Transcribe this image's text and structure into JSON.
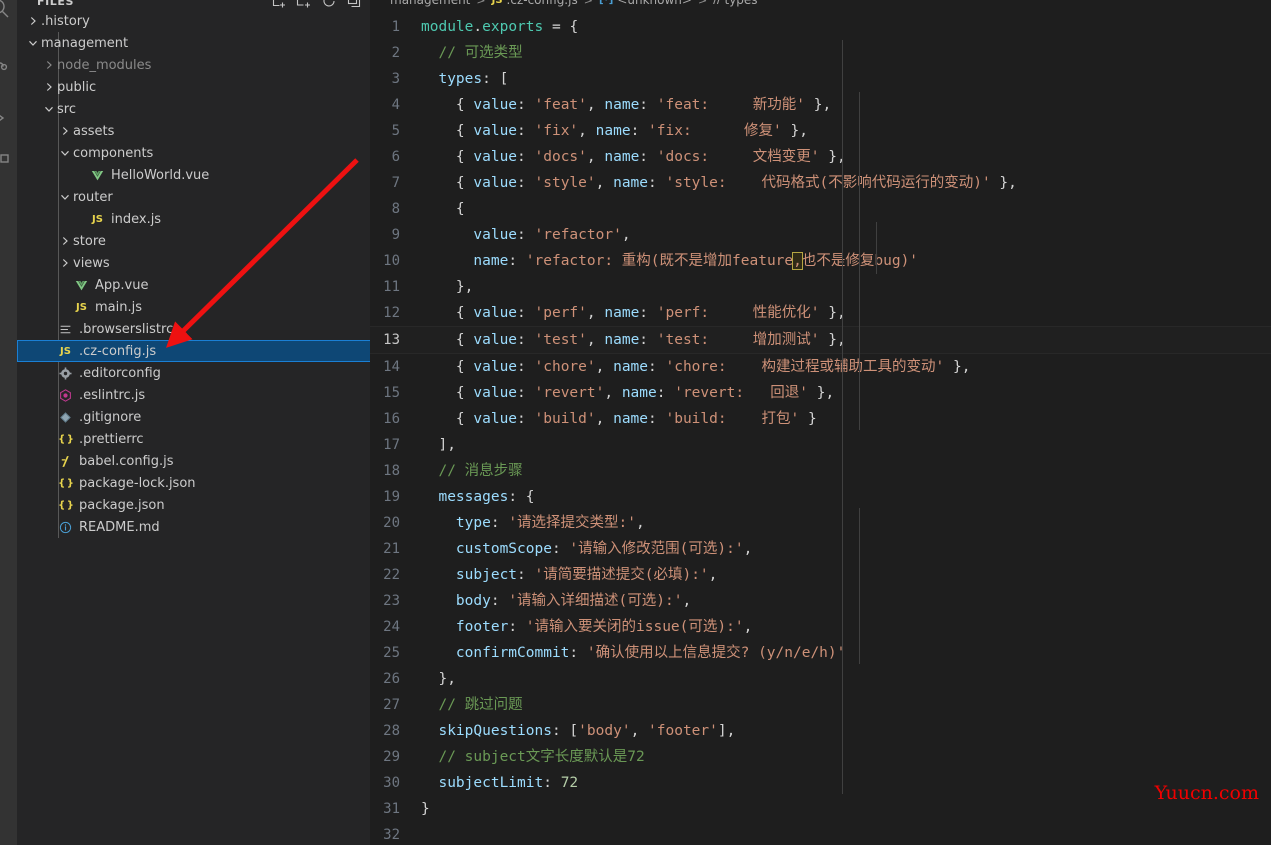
{
  "theme": {
    "editor_bg": "#1e1e1e",
    "sidebar_bg": "#252526",
    "activitybar_bg": "#333333",
    "selection_bg": "#0e4775",
    "selection_border": "#1a7fd4",
    "accent_arrow": "#ee1111",
    "watermark_color": "#f00000"
  },
  "activitybar": {
    "items": [
      {
        "name": "search-icon"
      },
      {
        "name": "source-control-icon"
      },
      {
        "name": "run-and-debug-icon"
      },
      {
        "name": "extensions-icon"
      }
    ]
  },
  "sidebar": {
    "title": "FILES",
    "actions": [
      {
        "name": "new-file-icon",
        "tooltip": "New File"
      },
      {
        "name": "new-folder-icon",
        "tooltip": "New Folder"
      },
      {
        "name": "refresh-icon",
        "tooltip": "Refresh Explorer"
      },
      {
        "name": "collapse-all-icon",
        "tooltip": "Collapse Folders in Explorer"
      }
    ],
    "tree": [
      {
        "label": ".history",
        "kind": "folder",
        "expanded": false,
        "depth": 1,
        "icon": "chevron-right-icon",
        "dim": false
      },
      {
        "label": "management",
        "kind": "folder",
        "expanded": true,
        "depth": 1,
        "icon": "chevron-down-icon",
        "dim": false
      },
      {
        "label": "node_modules",
        "kind": "folder",
        "expanded": false,
        "depth": 2,
        "icon": "chevron-right-icon",
        "dim": true
      },
      {
        "label": "public",
        "kind": "folder",
        "expanded": false,
        "depth": 2,
        "icon": "chevron-right-icon",
        "dim": false
      },
      {
        "label": "src",
        "kind": "folder",
        "expanded": true,
        "depth": 2,
        "icon": "chevron-down-icon",
        "dim": false
      },
      {
        "label": "assets",
        "kind": "folder",
        "expanded": false,
        "depth": 3,
        "icon": "chevron-right-icon",
        "dim": false
      },
      {
        "label": "components",
        "kind": "folder",
        "expanded": true,
        "depth": 3,
        "icon": "chevron-down-icon",
        "dim": false
      },
      {
        "label": "HelloWorld.vue",
        "kind": "file",
        "depth": 4,
        "icon": "vue-file-icon",
        "dim": false
      },
      {
        "label": "router",
        "kind": "folder",
        "expanded": true,
        "depth": 3,
        "icon": "chevron-down-icon",
        "dim": false
      },
      {
        "label": "index.js",
        "kind": "file",
        "depth": 4,
        "icon": "js-file-icon",
        "dim": false
      },
      {
        "label": "store",
        "kind": "folder",
        "expanded": false,
        "depth": 3,
        "icon": "chevron-right-icon",
        "dim": false
      },
      {
        "label": "views",
        "kind": "folder",
        "expanded": false,
        "depth": 3,
        "icon": "chevron-right-icon",
        "dim": false
      },
      {
        "label": "App.vue",
        "kind": "file",
        "depth": 3,
        "icon": "vue-file-icon",
        "dim": false
      },
      {
        "label": "main.js",
        "kind": "file",
        "depth": 3,
        "icon": "js-file-icon",
        "dim": false
      },
      {
        "label": ".browserslistrc",
        "kind": "file",
        "depth": 2,
        "icon": "config-list-icon",
        "dim": false
      },
      {
        "label": ".cz-config.js",
        "kind": "file",
        "depth": 2,
        "icon": "js-file-icon",
        "dim": false,
        "selected": true
      },
      {
        "label": ".editorconfig",
        "kind": "file",
        "depth": 2,
        "icon": "gear-file-icon",
        "dim": false
      },
      {
        "label": ".eslintrc.js",
        "kind": "file",
        "depth": 2,
        "icon": "eslint-file-icon",
        "dim": false
      },
      {
        "label": ".gitignore",
        "kind": "file",
        "depth": 2,
        "icon": "git-file-icon",
        "dim": false
      },
      {
        "label": ".prettierrc",
        "kind": "file",
        "depth": 2,
        "icon": "json-file-icon",
        "dim": false
      },
      {
        "label": "babel.config.js",
        "kind": "file",
        "depth": 2,
        "icon": "babel-file-icon",
        "dim": false
      },
      {
        "label": "package-lock.json",
        "kind": "file",
        "depth": 2,
        "icon": "json-file-icon",
        "dim": false
      },
      {
        "label": "package.json",
        "kind": "file",
        "depth": 2,
        "icon": "json-file-icon",
        "dim": false
      },
      {
        "label": "README.md",
        "kind": "file",
        "depth": 2,
        "icon": "markdown-info-icon",
        "dim": false
      }
    ]
  },
  "breadcrumb": {
    "items": [
      {
        "label": "management",
        "icon": null
      },
      {
        "label": ".cz-config.js",
        "icon": "js-file-icon"
      },
      {
        "label": "<unknown>",
        "icon": "module-icon"
      },
      {
        "label": "types",
        "icon": "property-icon"
      }
    ],
    "separator": ">"
  },
  "editor": {
    "active_line": 13,
    "line_count_visible": 32,
    "selection_text": ",",
    "lines": [
      {
        "n": 1,
        "tokens": [
          {
            "t": "module",
            "c": "teal"
          },
          {
            "t": ".",
            "c": "white"
          },
          {
            "t": "exports",
            "c": "teal"
          },
          {
            "t": " = ",
            "c": "white"
          },
          {
            "t": "{",
            "c": "punct"
          }
        ]
      },
      {
        "n": 2,
        "tokens": [
          {
            "t": "  ",
            "c": "white"
          },
          {
            "t": "// 可选类型",
            "c": "com"
          }
        ]
      },
      {
        "n": 3,
        "tokens": [
          {
            "t": "  ",
            "c": "white"
          },
          {
            "t": "types",
            "c": "lblue"
          },
          {
            "t": ": [",
            "c": "punct"
          }
        ]
      },
      {
        "n": 4,
        "tokens": [
          {
            "t": "    { ",
            "c": "punct"
          },
          {
            "t": "value",
            "c": "lblue"
          },
          {
            "t": ": ",
            "c": "punct"
          },
          {
            "t": "'feat'",
            "c": "str"
          },
          {
            "t": ", ",
            "c": "punct"
          },
          {
            "t": "name",
            "c": "lblue"
          },
          {
            "t": ": ",
            "c": "punct"
          },
          {
            "t": "'feat:     新功能'",
            "c": "str"
          },
          {
            "t": " },",
            "c": "punct"
          }
        ]
      },
      {
        "n": 5,
        "tokens": [
          {
            "t": "    { ",
            "c": "punct"
          },
          {
            "t": "value",
            "c": "lblue"
          },
          {
            "t": ": ",
            "c": "punct"
          },
          {
            "t": "'fix'",
            "c": "str"
          },
          {
            "t": ", ",
            "c": "punct"
          },
          {
            "t": "name",
            "c": "lblue"
          },
          {
            "t": ": ",
            "c": "punct"
          },
          {
            "t": "'fix:      修复'",
            "c": "str"
          },
          {
            "t": " },",
            "c": "punct"
          }
        ]
      },
      {
        "n": 6,
        "tokens": [
          {
            "t": "    { ",
            "c": "punct"
          },
          {
            "t": "value",
            "c": "lblue"
          },
          {
            "t": ": ",
            "c": "punct"
          },
          {
            "t": "'docs'",
            "c": "str"
          },
          {
            "t": ", ",
            "c": "punct"
          },
          {
            "t": "name",
            "c": "lblue"
          },
          {
            "t": ": ",
            "c": "punct"
          },
          {
            "t": "'docs:     文档变更'",
            "c": "str"
          },
          {
            "t": " },",
            "c": "punct"
          }
        ]
      },
      {
        "n": 7,
        "tokens": [
          {
            "t": "    { ",
            "c": "punct"
          },
          {
            "t": "value",
            "c": "lblue"
          },
          {
            "t": ": ",
            "c": "punct"
          },
          {
            "t": "'style'",
            "c": "str"
          },
          {
            "t": ", ",
            "c": "punct"
          },
          {
            "t": "name",
            "c": "lblue"
          },
          {
            "t": ": ",
            "c": "punct"
          },
          {
            "t": "'style:    代码格式(不影响代码运行的变动)'",
            "c": "str"
          },
          {
            "t": " },",
            "c": "punct"
          }
        ]
      },
      {
        "n": 8,
        "tokens": [
          {
            "t": "    {",
            "c": "punct"
          }
        ]
      },
      {
        "n": 9,
        "tokens": [
          {
            "t": "      ",
            "c": "white"
          },
          {
            "t": "value",
            "c": "lblue"
          },
          {
            "t": ": ",
            "c": "punct"
          },
          {
            "t": "'refactor'",
            "c": "str"
          },
          {
            "t": ",",
            "c": "punct"
          }
        ]
      },
      {
        "n": 10,
        "tokens": [
          {
            "t": "      ",
            "c": "white"
          },
          {
            "t": "name",
            "c": "lblue"
          },
          {
            "t": ": ",
            "c": "punct"
          },
          {
            "t": "'refactor: 重构(既不是增加feature",
            "c": "str"
          },
          {
            "t": ",",
            "c": "str",
            "sel": true
          },
          {
            "t": "也不是修复bug)'",
            "c": "str"
          }
        ]
      },
      {
        "n": 11,
        "tokens": [
          {
            "t": "    },",
            "c": "punct"
          }
        ]
      },
      {
        "n": 12,
        "tokens": [
          {
            "t": "    { ",
            "c": "punct"
          },
          {
            "t": "value",
            "c": "lblue"
          },
          {
            "t": ": ",
            "c": "punct"
          },
          {
            "t": "'perf'",
            "c": "str"
          },
          {
            "t": ", ",
            "c": "punct"
          },
          {
            "t": "name",
            "c": "lblue"
          },
          {
            "t": ": ",
            "c": "punct"
          },
          {
            "t": "'perf:     性能优化'",
            "c": "str"
          },
          {
            "t": " },",
            "c": "punct"
          }
        ]
      },
      {
        "n": 13,
        "tokens": [
          {
            "t": "    { ",
            "c": "punct"
          },
          {
            "t": "value",
            "c": "lblue"
          },
          {
            "t": ": ",
            "c": "punct"
          },
          {
            "t": "'test'",
            "c": "str"
          },
          {
            "t": ", ",
            "c": "punct"
          },
          {
            "t": "name",
            "c": "lblue"
          },
          {
            "t": ": ",
            "c": "punct"
          },
          {
            "t": "'test:     增加测试'",
            "c": "str"
          },
          {
            "t": " },",
            "c": "punct"
          }
        ]
      },
      {
        "n": 14,
        "tokens": [
          {
            "t": "    { ",
            "c": "punct"
          },
          {
            "t": "value",
            "c": "lblue"
          },
          {
            "t": ": ",
            "c": "punct"
          },
          {
            "t": "'chore'",
            "c": "str"
          },
          {
            "t": ", ",
            "c": "punct"
          },
          {
            "t": "name",
            "c": "lblue"
          },
          {
            "t": ": ",
            "c": "punct"
          },
          {
            "t": "'chore:    构建过程或辅助工具的变动'",
            "c": "str"
          },
          {
            "t": " },",
            "c": "punct"
          }
        ]
      },
      {
        "n": 15,
        "tokens": [
          {
            "t": "    { ",
            "c": "punct"
          },
          {
            "t": "value",
            "c": "lblue"
          },
          {
            "t": ": ",
            "c": "punct"
          },
          {
            "t": "'revert'",
            "c": "str"
          },
          {
            "t": ", ",
            "c": "punct"
          },
          {
            "t": "name",
            "c": "lblue"
          },
          {
            "t": ": ",
            "c": "punct"
          },
          {
            "t": "'revert:   回退'",
            "c": "str"
          },
          {
            "t": " },",
            "c": "punct"
          }
        ]
      },
      {
        "n": 16,
        "tokens": [
          {
            "t": "    { ",
            "c": "punct"
          },
          {
            "t": "value",
            "c": "lblue"
          },
          {
            "t": ": ",
            "c": "punct"
          },
          {
            "t": "'build'",
            "c": "str"
          },
          {
            "t": ", ",
            "c": "punct"
          },
          {
            "t": "name",
            "c": "lblue"
          },
          {
            "t": ": ",
            "c": "punct"
          },
          {
            "t": "'build:    打包'",
            "c": "str"
          },
          {
            "t": " }",
            "c": "punct"
          }
        ]
      },
      {
        "n": 17,
        "tokens": [
          {
            "t": "  ],",
            "c": "punct"
          }
        ]
      },
      {
        "n": 18,
        "tokens": [
          {
            "t": "  ",
            "c": "white"
          },
          {
            "t": "// 消息步骤",
            "c": "com"
          }
        ]
      },
      {
        "n": 19,
        "tokens": [
          {
            "t": "  ",
            "c": "white"
          },
          {
            "t": "messages",
            "c": "lblue"
          },
          {
            "t": ": {",
            "c": "punct"
          }
        ]
      },
      {
        "n": 20,
        "tokens": [
          {
            "t": "    ",
            "c": "white"
          },
          {
            "t": "type",
            "c": "lblue"
          },
          {
            "t": ": ",
            "c": "punct"
          },
          {
            "t": "'请选择提交类型:'",
            "c": "str"
          },
          {
            "t": ",",
            "c": "punct"
          }
        ]
      },
      {
        "n": 21,
        "tokens": [
          {
            "t": "    ",
            "c": "white"
          },
          {
            "t": "customScope",
            "c": "lblue"
          },
          {
            "t": ": ",
            "c": "punct"
          },
          {
            "t": "'请输入修改范围(可选):'",
            "c": "str"
          },
          {
            "t": ",",
            "c": "punct"
          }
        ]
      },
      {
        "n": 22,
        "tokens": [
          {
            "t": "    ",
            "c": "white"
          },
          {
            "t": "subject",
            "c": "lblue"
          },
          {
            "t": ": ",
            "c": "punct"
          },
          {
            "t": "'请简要描述提交(必填):'",
            "c": "str"
          },
          {
            "t": ",",
            "c": "punct"
          }
        ]
      },
      {
        "n": 23,
        "tokens": [
          {
            "t": "    ",
            "c": "white"
          },
          {
            "t": "body",
            "c": "lblue"
          },
          {
            "t": ": ",
            "c": "punct"
          },
          {
            "t": "'请输入详细描述(可选):'",
            "c": "str"
          },
          {
            "t": ",",
            "c": "punct"
          }
        ]
      },
      {
        "n": 24,
        "tokens": [
          {
            "t": "    ",
            "c": "white"
          },
          {
            "t": "footer",
            "c": "lblue"
          },
          {
            "t": ": ",
            "c": "punct"
          },
          {
            "t": "'请输入要关闭的issue(可选):'",
            "c": "str"
          },
          {
            "t": ",",
            "c": "punct"
          }
        ]
      },
      {
        "n": 25,
        "tokens": [
          {
            "t": "    ",
            "c": "white"
          },
          {
            "t": "confirmCommit",
            "c": "lblue"
          },
          {
            "t": ": ",
            "c": "punct"
          },
          {
            "t": "'确认使用以上信息提交? (y/n/e/h)'",
            "c": "str"
          }
        ]
      },
      {
        "n": 26,
        "tokens": [
          {
            "t": "  },",
            "c": "punct"
          }
        ]
      },
      {
        "n": 27,
        "tokens": [
          {
            "t": "  ",
            "c": "white"
          },
          {
            "t": "// 跳过问题",
            "c": "com"
          }
        ]
      },
      {
        "n": 28,
        "tokens": [
          {
            "t": "  ",
            "c": "white"
          },
          {
            "t": "skipQuestions",
            "c": "lblue"
          },
          {
            "t": ": [",
            "c": "punct"
          },
          {
            "t": "'body'",
            "c": "str"
          },
          {
            "t": ", ",
            "c": "punct"
          },
          {
            "t": "'footer'",
            "c": "str"
          },
          {
            "t": "],",
            "c": "punct"
          }
        ]
      },
      {
        "n": 29,
        "tokens": [
          {
            "t": "  ",
            "c": "white"
          },
          {
            "t": "// subject文字长度默认是72",
            "c": "com"
          }
        ]
      },
      {
        "n": 30,
        "tokens": [
          {
            "t": "  ",
            "c": "white"
          },
          {
            "t": "subjectLimit",
            "c": "lblue"
          },
          {
            "t": ": ",
            "c": "punct"
          },
          {
            "t": "72",
            "c": "num"
          }
        ]
      },
      {
        "n": 31,
        "tokens": [
          {
            "t": "}",
            "c": "punct"
          }
        ]
      },
      {
        "n": 32,
        "tokens": [
          {
            "t": "",
            "c": "white"
          }
        ]
      }
    ]
  },
  "annotation": {
    "arrow_name": "red-pointer-arrow",
    "points_to": ".cz-config.js"
  },
  "watermark": {
    "text": "Yuucn.com"
  }
}
